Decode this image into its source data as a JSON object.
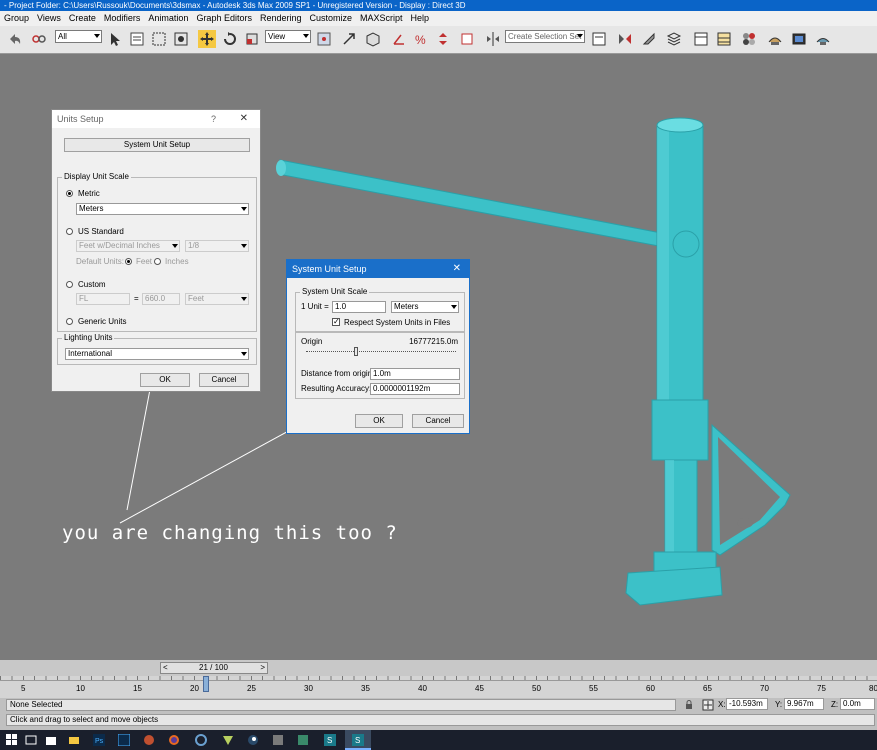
{
  "window": {
    "title": "- Project Folder: C:\\Users\\Russouk\\Documents\\3dsmax     - Autodesk 3ds Max  2009 SP1   - Unregistered Version    - Display : Direct 3D"
  },
  "menu": [
    "Group",
    "Views",
    "Create",
    "Modifiers",
    "Animation",
    "Graph Editors",
    "Rendering",
    "Customize",
    "MAXScript",
    "Help"
  ],
  "toolbar": {
    "filter_value": "All",
    "ref_coord_value": "View",
    "selection_set_placeholder": "Create Selection Set"
  },
  "units_setup": {
    "title": "Units Setup",
    "help_glyph": "?",
    "close_glyph": "✕",
    "system_unit_setup_label": "System Unit Setup",
    "display_group_label": "Display Unit Scale",
    "metric_label": "Metric",
    "metric_value": "Meters",
    "us_label": "US Standard",
    "us_value": "Feet w/Decimal Inches",
    "us_fraction": "1/8",
    "default_units_label": "Default Units:",
    "feet_label": "Feet",
    "inches_label": "Inches",
    "custom_label": "Custom",
    "custom_name": "FL",
    "custom_equals": "=",
    "custom_value": "660.0",
    "custom_unit": "Feet",
    "generic_label": "Generic Units",
    "lighting_group_label": "Lighting Units",
    "lighting_value": "International",
    "ok_label": "OK",
    "cancel_label": "Cancel"
  },
  "system_unit_setup": {
    "title": "System Unit Setup",
    "close_glyph": "✕",
    "scale_group_label": "System Unit Scale",
    "unit_label": "1 Unit =",
    "unit_value": "1.0",
    "unit_type": "Meters",
    "respect_label": "Respect System Units in Files",
    "respect_checked": true,
    "origin_label": "Origin",
    "origin_value": "16777215.0m",
    "distance_label": "Distance from origin:",
    "distance_value": "1.0m",
    "accuracy_label": "Resulting Accuracy:",
    "accuracy_value": "0.0000001192m",
    "ok_label": "OK",
    "cancel_label": "Cancel"
  },
  "annotation": {
    "text": "you are changing this too ?"
  },
  "timeline": {
    "frame_label": "21 / 100",
    "prev_glyph": "<",
    "next_glyph": ">",
    "ticks": [
      "5",
      "10",
      "15",
      "20",
      "25",
      "30",
      "35",
      "40",
      "45",
      "50",
      "55",
      "60",
      "65",
      "70",
      "75",
      "80"
    ]
  },
  "status": {
    "selection": "None Selected",
    "prompt": "Click and drag to select and move objects",
    "x_label": "X:",
    "x_value": "-10.593m",
    "y_label": "Y:",
    "y_value": "9.967m",
    "z_label": "Z:",
    "z_value": "0.0m"
  },
  "colors": {
    "model": "#3cc1c8",
    "viewport": "#7b7b7b",
    "title_blue": "#0a64c8",
    "annotation": "#ffffff"
  }
}
